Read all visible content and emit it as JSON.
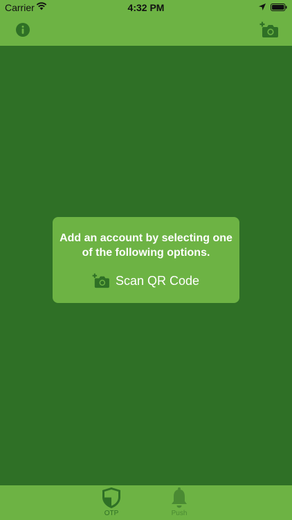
{
  "status_bar": {
    "carrier": "Carrier",
    "time": "4:32 PM",
    "icons": [
      "wifi-icon",
      "location-arrow-icon",
      "battery-icon"
    ]
  },
  "nav_bar": {
    "left_icon": "info-icon",
    "right_icon": "add-camera-icon"
  },
  "empty_state": {
    "message": "Add an account by selecting one of the following options.",
    "scan_button_label": "Scan QR Code",
    "scan_button_icon": "add-camera-icon"
  },
  "tab_bar": {
    "tabs": [
      {
        "label": "OTP",
        "icon": "shield-icon",
        "selected": true
      },
      {
        "label": "Push",
        "icon": "bell-icon",
        "selected": false
      }
    ]
  },
  "colors": {
    "bar_green": "#6db344",
    "background_green": "#2f7026",
    "card_green": "#6db344",
    "text_white": "#ffffff"
  }
}
